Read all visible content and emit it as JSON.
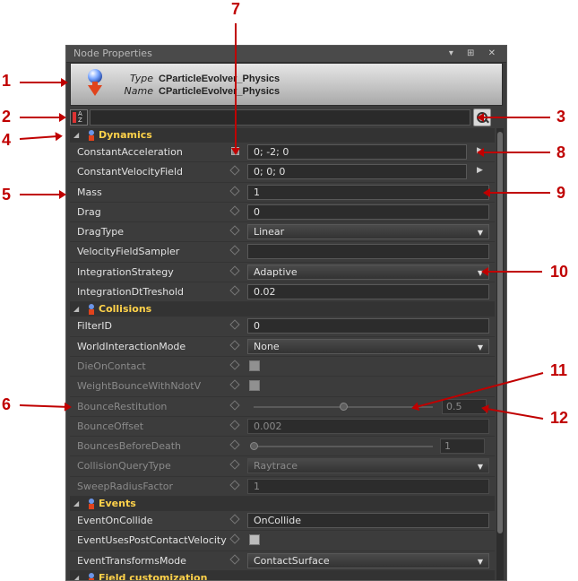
{
  "window": {
    "title": "Node Properties",
    "buttons": "▾ ⊞ ✕"
  },
  "header": {
    "type_label": "Type",
    "type_value": "CParticleEvolver_Physics",
    "name_label": "Name",
    "name_value": "CParticleEvolver_Physics"
  },
  "toolbar": {
    "sort_label": "A Z"
  },
  "sections": {
    "dynamics": "Dynamics",
    "collisions": "Collisions",
    "events": "Events",
    "field_customization": "Field customization"
  },
  "props": {
    "constant_acceleration": {
      "name": "ConstantAcceleration",
      "value": "0; -2; 0"
    },
    "constant_velocity_field": {
      "name": "ConstantVelocityField",
      "value": "0; 0; 0"
    },
    "mass": {
      "name": "Mass",
      "value": "1"
    },
    "drag": {
      "name": "Drag",
      "value": "0"
    },
    "drag_type": {
      "name": "DragType",
      "value": "Linear"
    },
    "velocity_field_sampler": {
      "name": "VelocityFieldSampler",
      "value": ""
    },
    "integration_strategy": {
      "name": "IntegrationStrategy",
      "value": "Adaptive"
    },
    "integration_dt_treshold": {
      "name": "IntegrationDtTreshold",
      "value": "0.02"
    },
    "filter_id": {
      "name": "FilterID",
      "value": "0"
    },
    "world_interaction_mode": {
      "name": "WorldInteractionMode",
      "value": "None"
    },
    "die_on_contact": {
      "name": "DieOnContact"
    },
    "weight_bounce": {
      "name": "WeightBounceWithNdotV"
    },
    "bounce_restitution": {
      "name": "BounceRestitution",
      "value": "0.5",
      "slider_fraction": 0.5
    },
    "bounce_offset": {
      "name": "BounceOffset",
      "value": "0.002"
    },
    "bounces_before_death": {
      "name": "BouncesBeforeDeath",
      "value": "1",
      "slider_fraction": 0.0
    },
    "collision_query_type": {
      "name": "CollisionQueryType",
      "value": "Raytrace"
    },
    "sweep_radius_factor": {
      "name": "SweepRadiusFactor",
      "value": "1"
    },
    "event_on_collide": {
      "name": "EventOnCollide",
      "value": "OnCollide"
    },
    "event_uses_post_contact_velocity": {
      "name": "EventUsesPostContactVelocity"
    },
    "event_transforms_mode": {
      "name": "EventTransformsMode",
      "value": "ContactSurface"
    }
  },
  "callouts": [
    "1",
    "2",
    "3",
    "4",
    "5",
    "6",
    "7",
    "8",
    "9",
    "10",
    "11",
    "12"
  ],
  "colors": {
    "callout": "#c00000",
    "section_title": "#ffd24a",
    "panel_bg": "#3c3c3c"
  }
}
